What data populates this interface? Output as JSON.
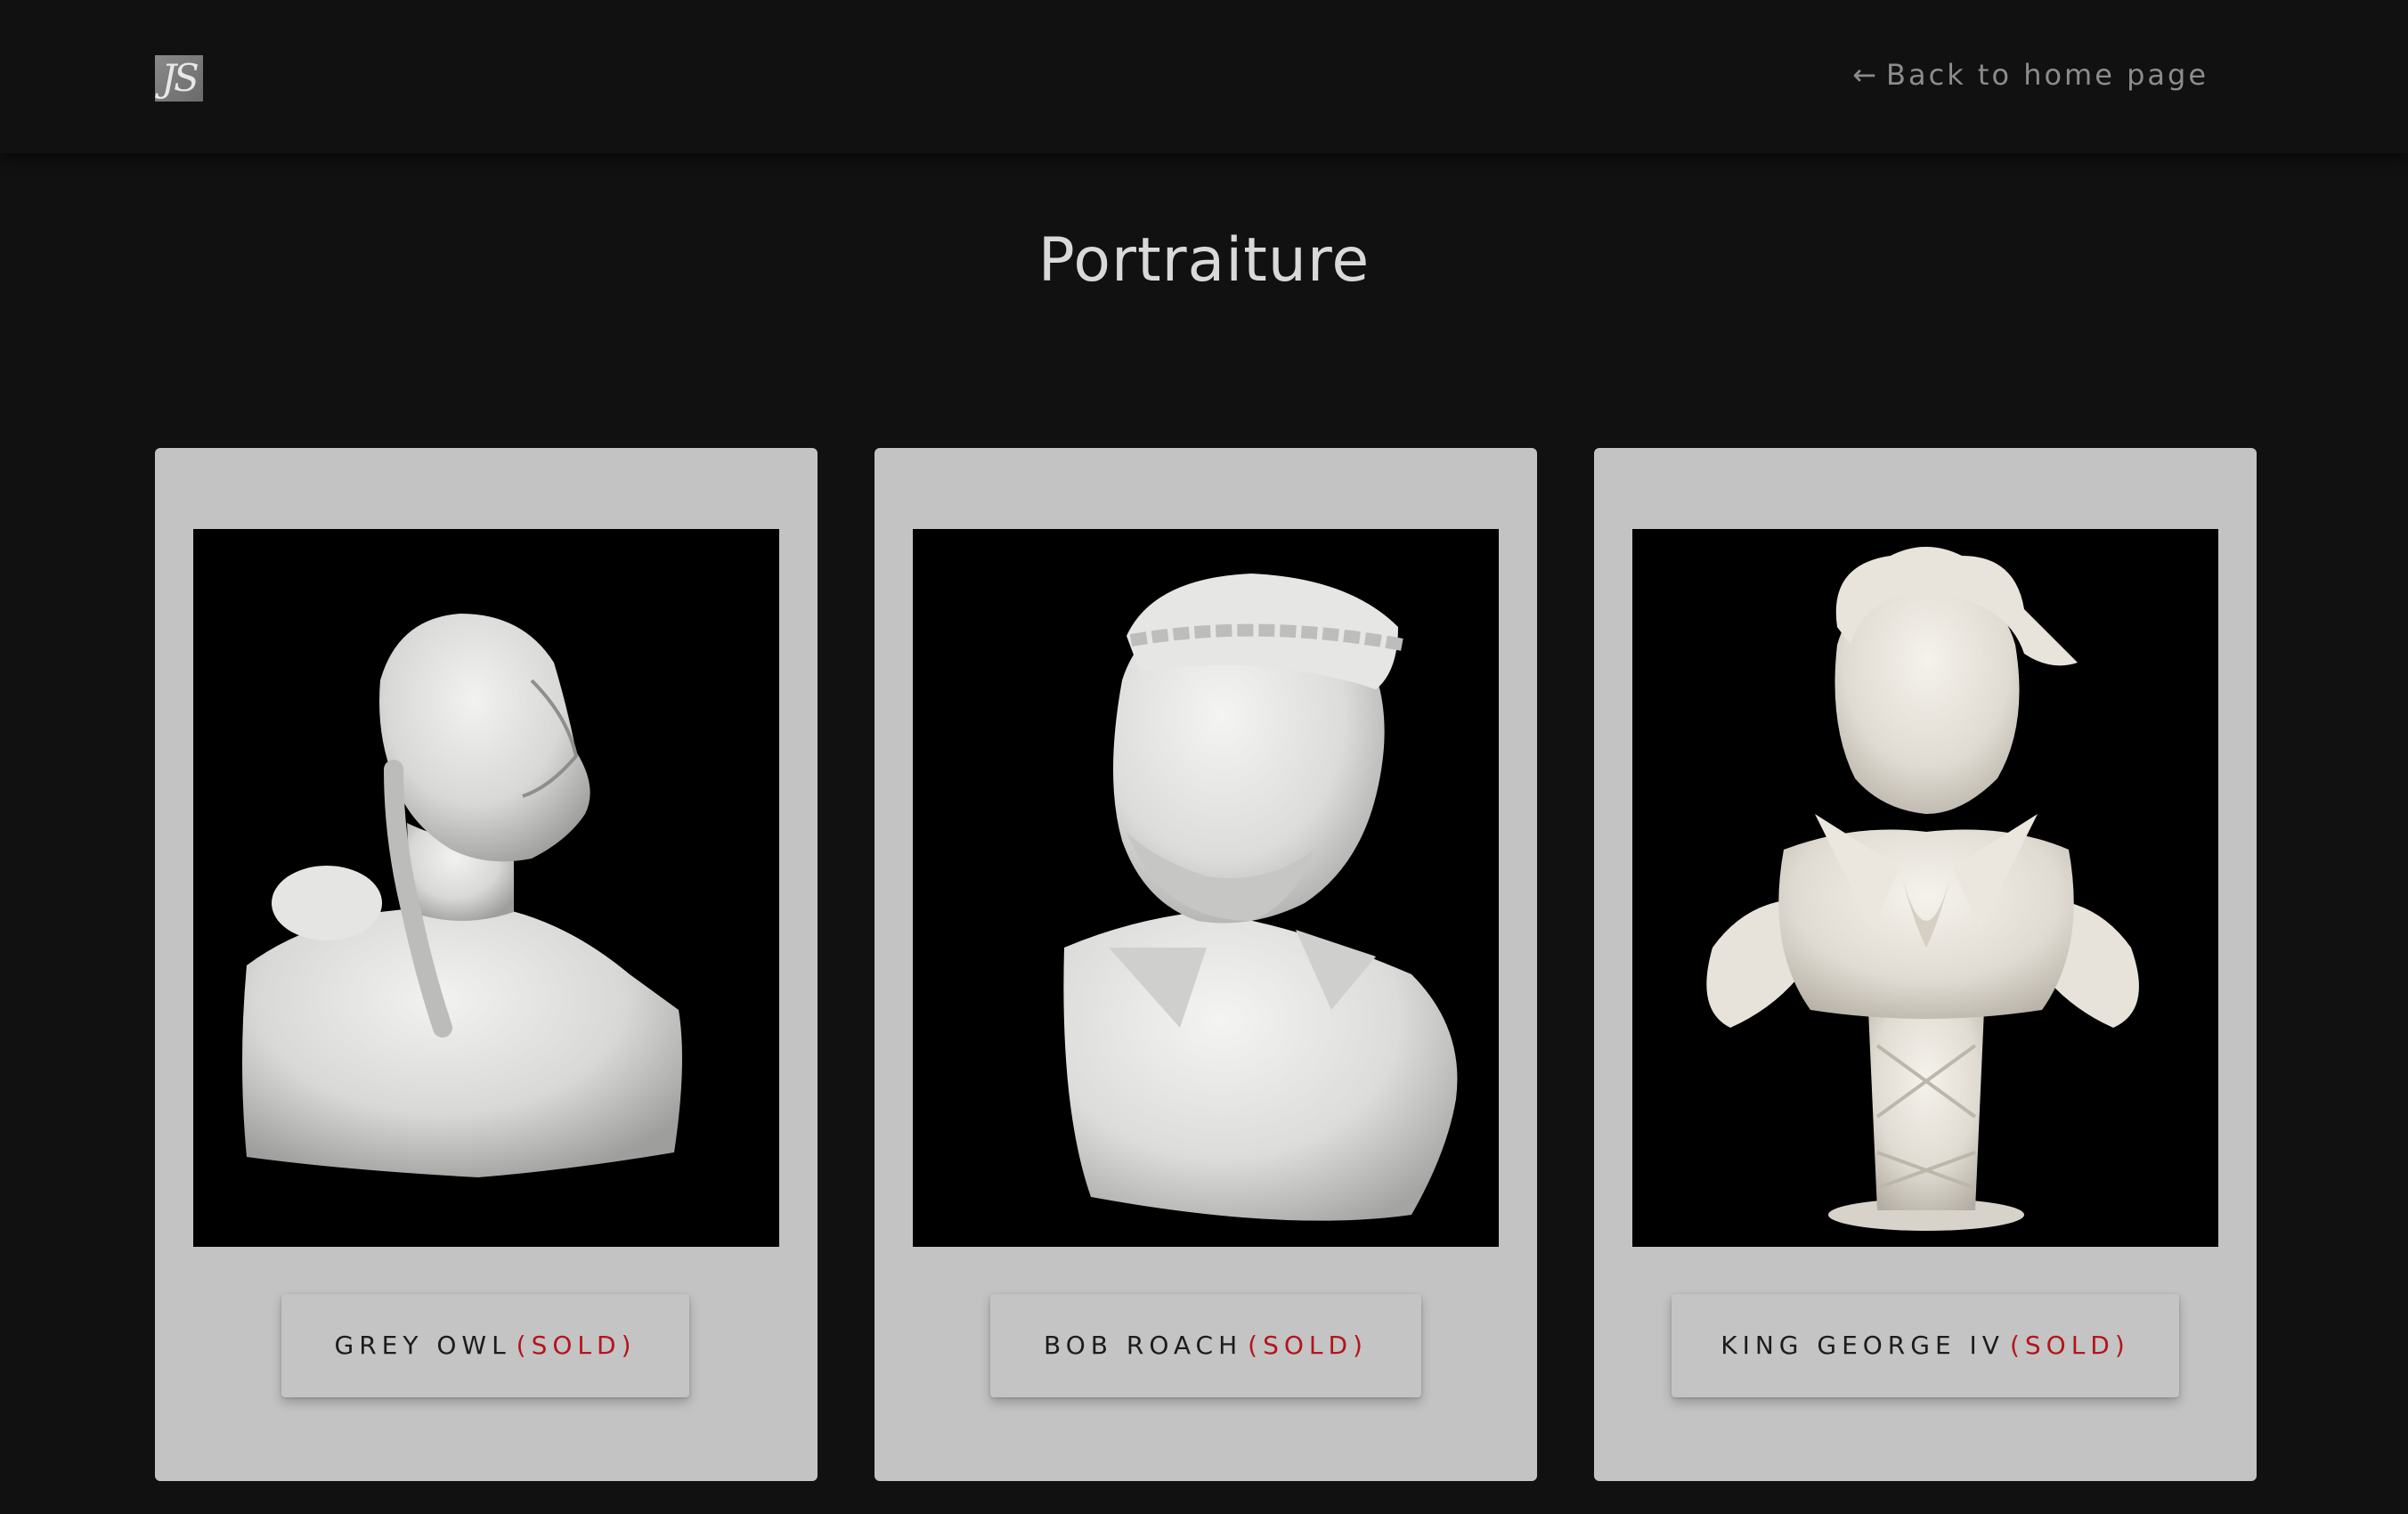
{
  "header": {
    "logo_text": "JS",
    "back_link": {
      "arrow": "←",
      "label": "Back to home page",
      "icon": "arrow-left-icon"
    }
  },
  "page": {
    "title": "Portraiture"
  },
  "artworks": [
    {
      "name": "GREY OWL",
      "status": "(SOLD)",
      "image_alt": "White sculpted bust of Grey Owl with braided hair and a small animal on his shoulder"
    },
    {
      "name": "BOB ROACH",
      "status": "(SOLD)",
      "image_alt": "White sculpted bust of Bob Roach wearing a cap and collared shirt"
    },
    {
      "name": "KING GEORGE IV",
      "status": "(SOLD)",
      "image_alt": "White sculpted bust of King George IV with ruffled collar on a pedestal"
    }
  ],
  "colors": {
    "background": "#111111",
    "card": "#c3c3c3",
    "sold": "#b3151b",
    "title": "#d9d9d9"
  }
}
